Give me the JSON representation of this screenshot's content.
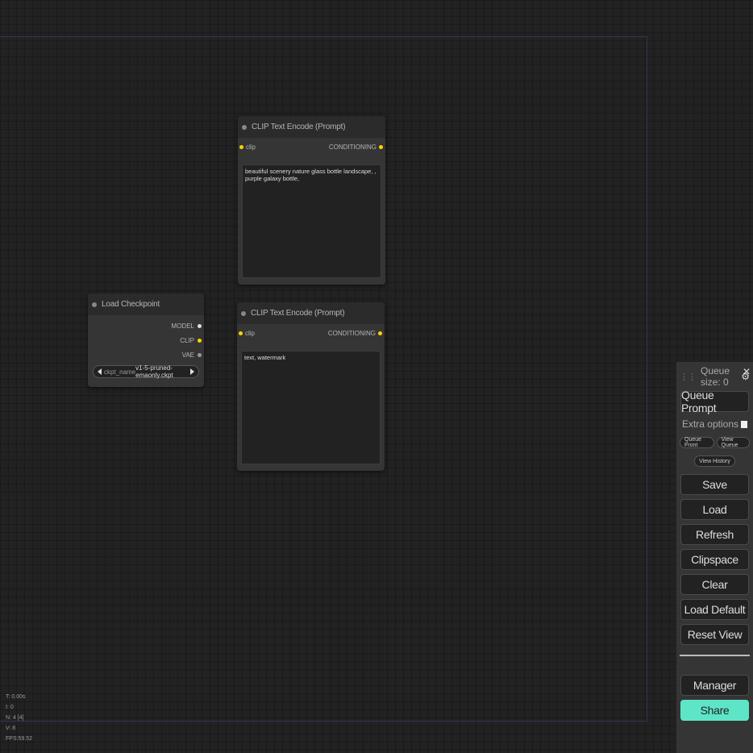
{
  "nodes": {
    "clip_pos": {
      "title": "CLIP Text Encode (Prompt)",
      "input": "clip",
      "output": "CONDITIONING",
      "text": "beautiful scenery nature glass bottle landscape, , purple galaxy bottle,"
    },
    "clip_neg": {
      "title": "CLIP Text Encode (Prompt)",
      "input": "clip",
      "output": "CONDITIONING",
      "text": "text, watermark"
    },
    "checkpoint": {
      "title": "Load Checkpoint",
      "outputs": [
        "MODEL",
        "CLIP",
        "VAE"
      ],
      "widget_name": "ckpt_name",
      "widget_value": "v1-5-pruned-emaonly.ckpt"
    }
  },
  "menu": {
    "queue_size": "Queue size: 0",
    "queue_prompt": "Queue Prompt",
    "extra_options": "Extra options",
    "queue_front": "Queue Front",
    "view_queue": "View Queue",
    "view_history": "View History",
    "buttons": [
      "Save",
      "Load",
      "Refresh",
      "Clipspace",
      "Clear",
      "Load Default",
      "Reset View"
    ],
    "manager": "Manager",
    "share": "Share"
  },
  "stats": [
    "T: 0.00s",
    "I: 0",
    "N: 4 [4]",
    "V: 8",
    "FPS:59.52"
  ],
  "colors": {
    "clip_slot": "#ffd500",
    "share_button": "#5ee5c7",
    "canvas": "#222222"
  }
}
